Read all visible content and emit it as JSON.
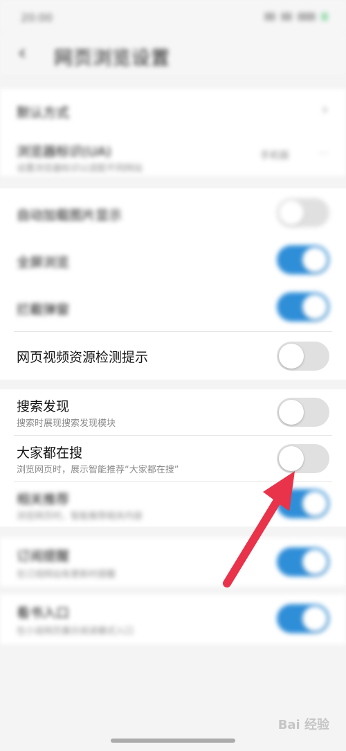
{
  "status_bar": {
    "time": "20:00"
  },
  "header": {
    "back_glyph": "‹",
    "title": "网页浏览设置"
  },
  "section1": {
    "rows": [
      {
        "label": "默认方式"
      },
      {
        "label": "浏览器标识(UA)",
        "sub": "设置浏览器标识以适配不同网站",
        "value": "手机版"
      }
    ]
  },
  "section2": {
    "rows": [
      {
        "label": "自动加载图片显示",
        "toggle": "off"
      },
      {
        "label": "全屏浏览",
        "toggle": "on"
      },
      {
        "label": "拦截弹窗",
        "toggle": "on"
      },
      {
        "label": "网页视频资源检测提示",
        "toggle": "off"
      }
    ]
  },
  "section3": {
    "rows": [
      {
        "label": "搜索发现",
        "sub": "搜索时展现搜索发现模块",
        "toggle": "off"
      },
      {
        "label": "大家都在搜",
        "sub": "浏览网页时，展示智能推荐“大家都在搜”",
        "toggle": "off"
      },
      {
        "label": "相关推荐",
        "sub": "浏览网页时，智能推荐相关内容",
        "toggle": "on"
      }
    ]
  },
  "section4": {
    "rows": [
      {
        "label": "订阅提醒",
        "sub": "在订阅网站有更新时提醒",
        "toggle": "on"
      }
    ]
  },
  "section5": {
    "rows": [
      {
        "label": "看书入口",
        "sub": "在小说网页展示阅读模式入口",
        "toggle": "on"
      }
    ]
  },
  "watermark": "Bai 经验",
  "colors": {
    "toggle_on": "#2f8ed8",
    "toggle_off": "#e0e0e0",
    "arrow": "#e8334a"
  }
}
